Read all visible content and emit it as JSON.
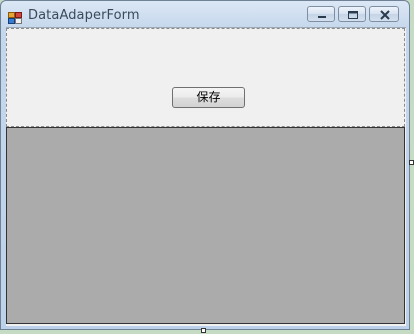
{
  "window": {
    "title": "DataAdaperForm",
    "icon": "app-form-icon",
    "controls": {
      "minimize_icon": "minimize-icon",
      "maximize_icon": "maximize-icon",
      "close_icon": "close-icon"
    }
  },
  "top_panel": {
    "save_button_label": "保存"
  },
  "grid_view": {
    "background_color": "#ababab"
  },
  "colors": {
    "desktop": "#c6dbc4",
    "form_background": "#f0f0f0",
    "title_text": "#3b4a5a"
  }
}
